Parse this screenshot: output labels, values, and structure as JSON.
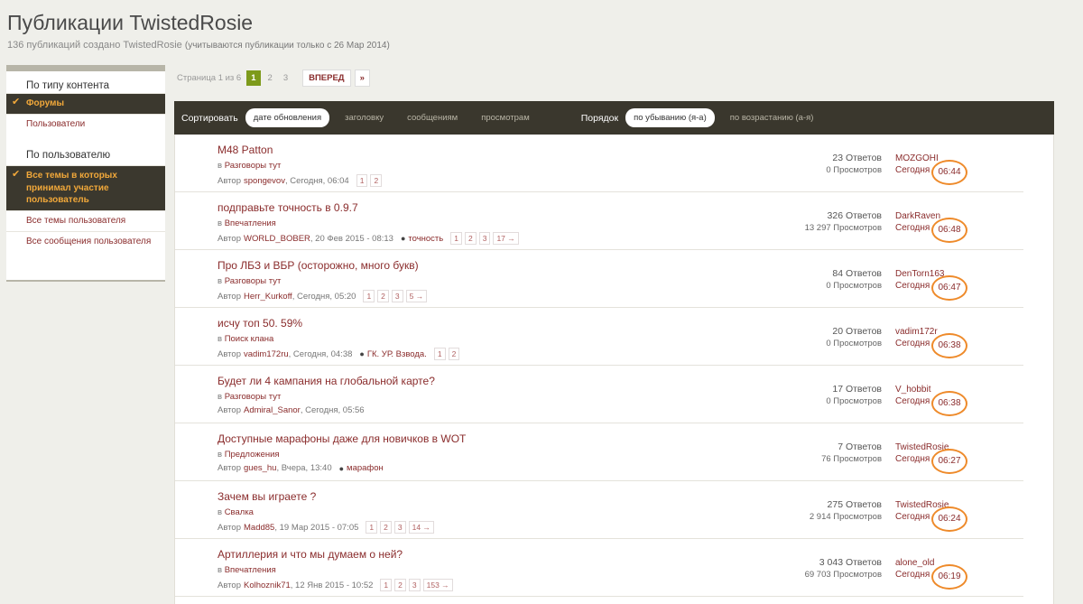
{
  "page": {
    "title": "Публикации TwistedRosie",
    "subtitle_main": "136 публикаций создано TwistedRosie",
    "subtitle_note": "(учитываются публикации только с 26 Мар 2014)"
  },
  "sidebar": {
    "content_type_heading": "По типу контента",
    "content_items": [
      {
        "label": "Форумы",
        "active": true
      },
      {
        "label": "Пользователи",
        "active": false
      }
    ],
    "user_heading": "По пользователю",
    "user_items": [
      {
        "label": "Все темы в которых принимал участие пользователь",
        "active": true
      },
      {
        "label": "Все темы пользователя",
        "active": false
      },
      {
        "label": "Все сообщения пользователя",
        "active": false
      }
    ]
  },
  "pagination": {
    "label": "Страница 1 из 6",
    "pages": [
      "1",
      "2",
      "3"
    ],
    "current": "1",
    "next": "ВПЕРЕД",
    "last": "»"
  },
  "sortbar": {
    "sort_label": "Сортировать",
    "sort_options": [
      "дате обновления",
      "заголовку",
      "сообщениям",
      "просмотрам"
    ],
    "sort_active": "дате обновления",
    "order_label": "Порядок",
    "order_options": [
      "по убыванию (я-а)",
      "по возрастанию (а-я)"
    ],
    "order_active": "по убыванию (я-а)"
  },
  "topics": [
    {
      "title": "M48 Patton",
      "in": "в",
      "forum": "Разговоры тут",
      "by": "Автор",
      "author": "spongevov",
      "date": ", Сегодня, 06:04",
      "tag": "",
      "pages": [
        "1",
        "2"
      ],
      "replies": "23 Ответов",
      "views": "0 Просмотров",
      "last_user": "MOZGOHI",
      "last_when": "Сегодня",
      "last_time": "06:44"
    },
    {
      "title": "подправьте точность в 0.9.7",
      "in": "в",
      "forum": "Впечатления",
      "by": "Автор",
      "author": "WORLD_BOBER",
      "date": ", 20 Фев 2015 - 08:13",
      "tag": "точность",
      "pages": [
        "1",
        "2",
        "3",
        "17 →"
      ],
      "replies": "326 Ответов",
      "views": "13 297 Просмотров",
      "last_user": "DarkRaven",
      "last_when": "Сегодня",
      "last_time": "06:48"
    },
    {
      "title": "Про ЛБЗ и ВБР (осторожно, много букв)",
      "in": "в",
      "forum": "Разговоры тут",
      "by": "Автор",
      "author": "Herr_Kurkoff",
      "date": ", Сегодня, 05:20",
      "tag": "",
      "pages": [
        "1",
        "2",
        "3",
        "5 →"
      ],
      "replies": "84 Ответов",
      "views": "0 Просмотров",
      "last_user": "DenTorn163",
      "last_when": "Сегодня",
      "last_time": "06:47"
    },
    {
      "title": "исчу топ 50. 59%",
      "in": "в",
      "forum": "Поиск клана",
      "by": "Автор",
      "author": "vadim172ru",
      "date": ", Сегодня, 04:38",
      "tag": "ГК. УР. Взвода.",
      "pages": [
        "1",
        "2"
      ],
      "replies": "20 Ответов",
      "views": "0 Просмотров",
      "last_user": "vadim172r",
      "last_when": "Сегодня",
      "last_time": "06:38"
    },
    {
      "title": "Будет ли 4 кампания на глобальной карте?",
      "in": "в",
      "forum": "Разговоры тут",
      "by": "Автор",
      "author": "Admiral_Sanor",
      "date": ", Сегодня, 05:56",
      "tag": "",
      "pages": [],
      "replies": "17 Ответов",
      "views": "0 Просмотров",
      "last_user": "V_hobbit",
      "last_when": "Сегодня",
      "last_time": "06:38"
    },
    {
      "title": "Доступные марафоны даже для новичков в WOT",
      "in": "в",
      "forum": "Предложения",
      "by": "Автор",
      "author": "gues_hu",
      "date": ", Вчера, 13:40",
      "tag": "марафон",
      "pages": [],
      "replies": "7 Ответов",
      "views": "76 Просмотров",
      "last_user": "TwistedRosie",
      "last_when": "Сегодня",
      "last_time": "06:27"
    },
    {
      "title": "Зачем вы играете ?",
      "in": "в",
      "forum": "Свалка",
      "by": "Автор",
      "author": "Madd85",
      "date": ", 19 Мар 2015 - 07:05",
      "tag": "",
      "pages": [
        "1",
        "2",
        "3",
        "14 →"
      ],
      "replies": "275 Ответов",
      "views": "2 914 Просмотров",
      "last_user": "TwistedRosie",
      "last_when": "Сегодня",
      "last_time": "06:24"
    },
    {
      "title": "Артиллерия и что мы думаем о ней?",
      "in": "в",
      "forum": "Впечатления",
      "by": "Автор",
      "author": "Kolhoznik71",
      "date": ", 12 Янв 2015 - 10:52",
      "tag": "",
      "pages": [
        "1",
        "2",
        "3",
        "153 →"
      ],
      "replies": "3 043 Ответов",
      "views": "69 703 Просмотров",
      "last_user": "alone_old",
      "last_when": "Сегодня",
      "last_time": "06:19"
    }
  ]
}
